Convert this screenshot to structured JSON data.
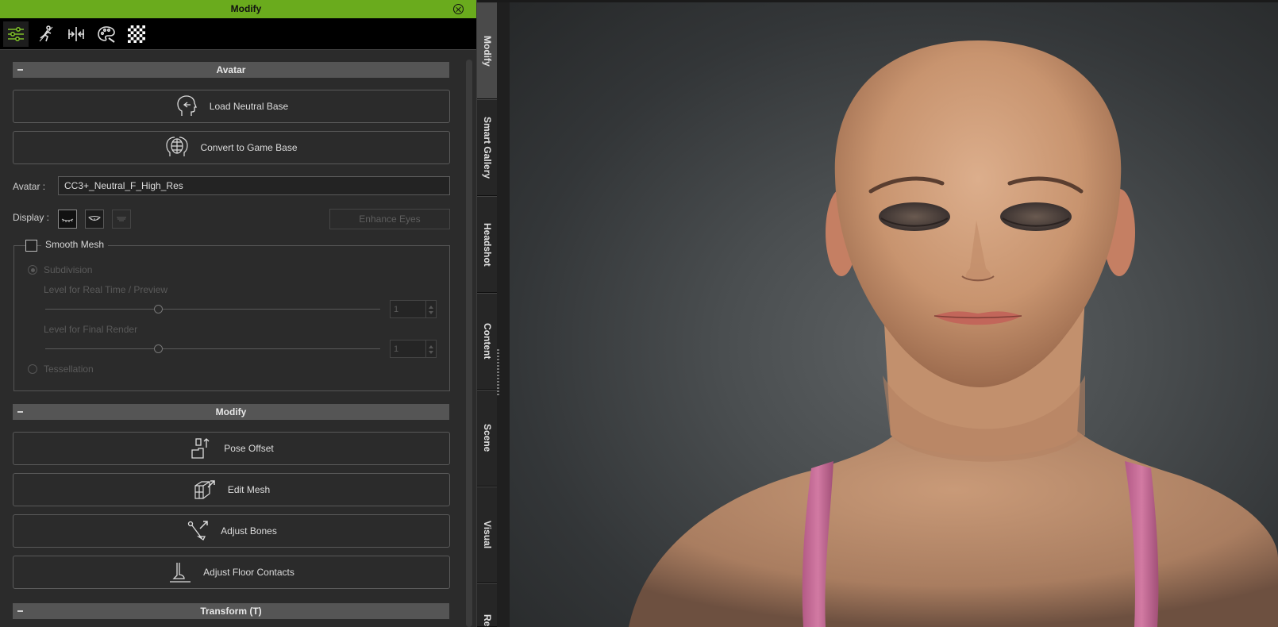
{
  "window": {
    "title": "Modify"
  },
  "toolbar": {
    "tools": [
      "sliders-icon",
      "run-pose-icon",
      "compress-icon",
      "palette-icon",
      "checker-icon"
    ]
  },
  "avatar_section": {
    "header": "Avatar",
    "load_neutral_base": "Load Neutral Base",
    "convert_to_game_base": "Convert to Game Base",
    "avatar_label": "Avatar :",
    "avatar_value": "CC3+_Neutral_F_High_Res",
    "display_label": "Display :",
    "enhance_eyes": "Enhance Eyes",
    "smooth_mesh": {
      "label": "Smooth Mesh",
      "checked": false,
      "subdivision_label": "Subdivision",
      "level_realtime_label": "Level for Real Time / Preview",
      "level_realtime_value": "1",
      "level_final_label": "Level for Final Render",
      "level_final_value": "1",
      "tessellation_label": "Tessellation"
    }
  },
  "modify_section": {
    "header": "Modify",
    "pose_offset": "Pose Offset",
    "edit_mesh": "Edit Mesh",
    "adjust_bones": "Adjust Bones",
    "adjust_floor_contacts": "Adjust Floor Contacts"
  },
  "transform_section": {
    "header": "Transform  (T)"
  },
  "side_tabs": [
    "Modify",
    "Smart Gallery",
    "Headshot",
    "Content",
    "Scene",
    "Visual",
    "Re"
  ],
  "colors": {
    "accent": "#6aab1d",
    "panel": "#2b2b2b",
    "viewport": "#4a4e50"
  }
}
